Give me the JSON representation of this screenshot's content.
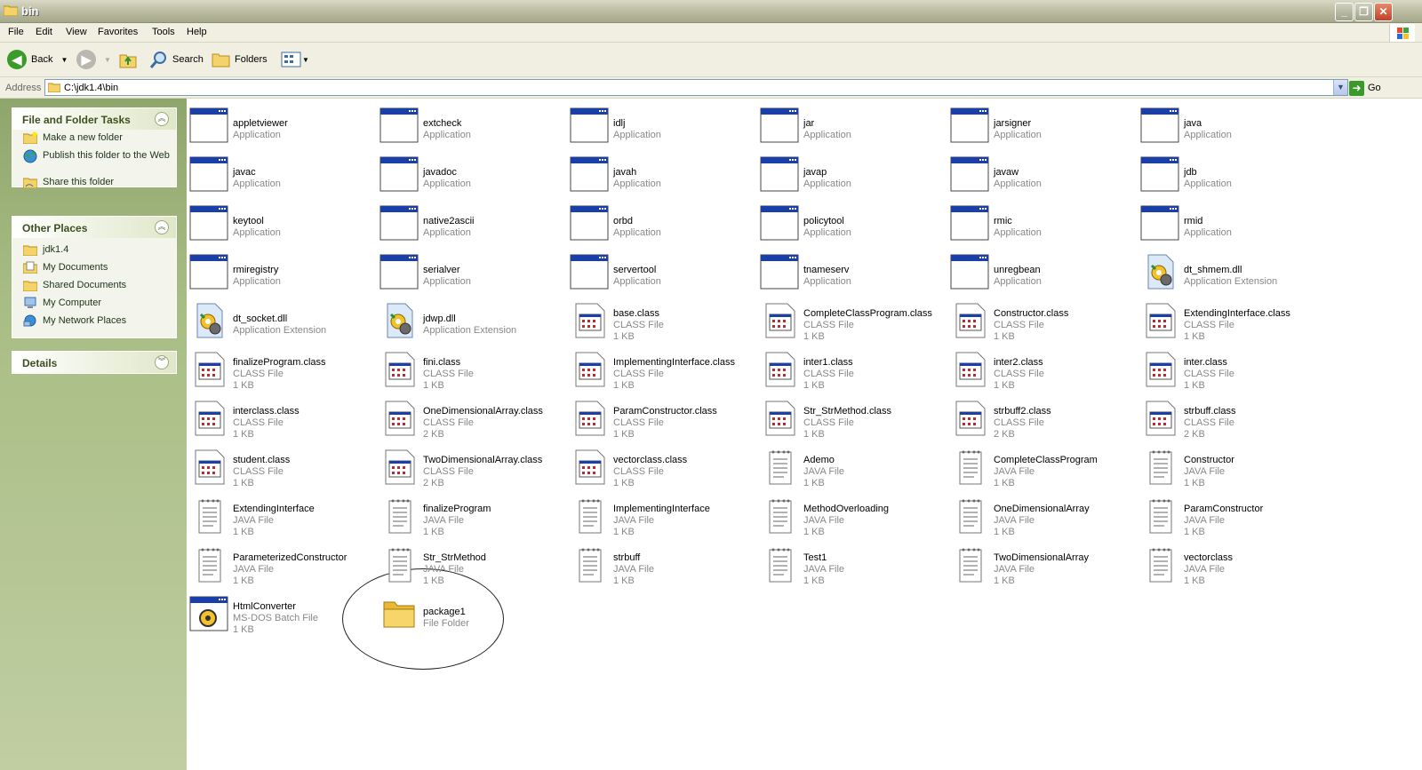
{
  "window": {
    "title": "bin"
  },
  "menu": [
    "File",
    "Edit",
    "View",
    "Favorites",
    "Tools",
    "Help"
  ],
  "toolbar": {
    "back_label": "Back",
    "search_label": "Search",
    "folders_label": "Folders"
  },
  "address": {
    "label": "Address",
    "value": "C:\\jdk1.4\\bin",
    "go_label": "Go"
  },
  "tasks_panel": {
    "title": "File and Folder Tasks",
    "items": [
      {
        "label": "Make a new folder",
        "icon": "new-folder-icon"
      },
      {
        "label": "Publish this folder to the Web",
        "icon": "globe-icon"
      },
      {
        "label": "Share this folder",
        "icon": "share-folder-icon"
      }
    ]
  },
  "places_panel": {
    "title": "Other Places",
    "items": [
      {
        "label": "jdk1.4",
        "icon": "folder-icon"
      },
      {
        "label": "My Documents",
        "icon": "documents-icon"
      },
      {
        "label": "Shared Documents",
        "icon": "folder-icon"
      },
      {
        "label": "My Computer",
        "icon": "computer-icon"
      },
      {
        "label": "My Network Places",
        "icon": "network-icon"
      }
    ]
  },
  "details_panel": {
    "title": "Details"
  },
  "files": [
    {
      "name": "appletviewer",
      "type": "Application",
      "size": "",
      "icon": "app"
    },
    {
      "name": "extcheck",
      "type": "Application",
      "size": "",
      "icon": "app"
    },
    {
      "name": "idlj",
      "type": "Application",
      "size": "",
      "icon": "app"
    },
    {
      "name": "jar",
      "type": "Application",
      "size": "",
      "icon": "app"
    },
    {
      "name": "jarsigner",
      "type": "Application",
      "size": "",
      "icon": "app"
    },
    {
      "name": "java",
      "type": "Application",
      "size": "",
      "icon": "app"
    },
    {
      "name": "javac",
      "type": "Application",
      "size": "",
      "icon": "app"
    },
    {
      "name": "javadoc",
      "type": "Application",
      "size": "",
      "icon": "app"
    },
    {
      "name": "javah",
      "type": "Application",
      "size": "",
      "icon": "app"
    },
    {
      "name": "javap",
      "type": "Application",
      "size": "",
      "icon": "app"
    },
    {
      "name": "javaw",
      "type": "Application",
      "size": "",
      "icon": "app"
    },
    {
      "name": "jdb",
      "type": "Application",
      "size": "",
      "icon": "app"
    },
    {
      "name": "keytool",
      "type": "Application",
      "size": "",
      "icon": "app"
    },
    {
      "name": "native2ascii",
      "type": "Application",
      "size": "",
      "icon": "app"
    },
    {
      "name": "orbd",
      "type": "Application",
      "size": "",
      "icon": "app"
    },
    {
      "name": "policytool",
      "type": "Application",
      "size": "",
      "icon": "app"
    },
    {
      "name": "rmic",
      "type": "Application",
      "size": "",
      "icon": "app"
    },
    {
      "name": "rmid",
      "type": "Application",
      "size": "",
      "icon": "app"
    },
    {
      "name": "rmiregistry",
      "type": "Application",
      "size": "",
      "icon": "app"
    },
    {
      "name": "serialver",
      "type": "Application",
      "size": "",
      "icon": "app"
    },
    {
      "name": "servertool",
      "type": "Application",
      "size": "",
      "icon": "app"
    },
    {
      "name": "tnameserv",
      "type": "Application",
      "size": "",
      "icon": "app"
    },
    {
      "name": "unregbean",
      "type": "Application",
      "size": "",
      "icon": "app"
    },
    {
      "name": "dt_shmem.dll",
      "type": "Application Extension",
      "size": "",
      "icon": "dll"
    },
    {
      "name": "dt_socket.dll",
      "type": "Application Extension",
      "size": "",
      "icon": "dll"
    },
    {
      "name": "jdwp.dll",
      "type": "Application Extension",
      "size": "",
      "icon": "dll"
    },
    {
      "name": "base.class",
      "type": "CLASS File",
      "size": "1 KB",
      "icon": "class"
    },
    {
      "name": "CompleteClassProgram.class",
      "type": "CLASS File",
      "size": "1 KB",
      "icon": "class"
    },
    {
      "name": "Constructor.class",
      "type": "CLASS File",
      "size": "1 KB",
      "icon": "class"
    },
    {
      "name": "ExtendingInterface.class",
      "type": "CLASS File",
      "size": "1 KB",
      "icon": "class"
    },
    {
      "name": "finalizeProgram.class",
      "type": "CLASS File",
      "size": "1 KB",
      "icon": "class"
    },
    {
      "name": "fini.class",
      "type": "CLASS File",
      "size": "1 KB",
      "icon": "class"
    },
    {
      "name": "ImplementingInterface.class",
      "type": "CLASS File",
      "size": "1 KB",
      "icon": "class"
    },
    {
      "name": "inter1.class",
      "type": "CLASS File",
      "size": "1 KB",
      "icon": "class"
    },
    {
      "name": "inter2.class",
      "type": "CLASS File",
      "size": "1 KB",
      "icon": "class"
    },
    {
      "name": "inter.class",
      "type": "CLASS File",
      "size": "1 KB",
      "icon": "class"
    },
    {
      "name": "interclass.class",
      "type": "CLASS File",
      "size": "1 KB",
      "icon": "class"
    },
    {
      "name": "OneDimensionalArray.class",
      "type": "CLASS File",
      "size": "2 KB",
      "icon": "class"
    },
    {
      "name": "ParamConstructor.class",
      "type": "CLASS File",
      "size": "1 KB",
      "icon": "class"
    },
    {
      "name": "Str_StrMethod.class",
      "type": "CLASS File",
      "size": "1 KB",
      "icon": "class"
    },
    {
      "name": "strbuff2.class",
      "type": "CLASS File",
      "size": "2 KB",
      "icon": "class"
    },
    {
      "name": "strbuff.class",
      "type": "CLASS File",
      "size": "2 KB",
      "icon": "class"
    },
    {
      "name": "student.class",
      "type": "CLASS File",
      "size": "1 KB",
      "icon": "class"
    },
    {
      "name": "TwoDimensionalArray.class",
      "type": "CLASS File",
      "size": "2 KB",
      "icon": "class"
    },
    {
      "name": "vectorclass.class",
      "type": "CLASS File",
      "size": "1 KB",
      "icon": "class"
    },
    {
      "name": "Ademo",
      "type": "JAVA File",
      "size": "1 KB",
      "icon": "java"
    },
    {
      "name": "CompleteClassProgram",
      "type": "JAVA File",
      "size": "1 KB",
      "icon": "java"
    },
    {
      "name": "Constructor",
      "type": "JAVA File",
      "size": "1 KB",
      "icon": "java"
    },
    {
      "name": "ExtendingInterface",
      "type": "JAVA File",
      "size": "1 KB",
      "icon": "java"
    },
    {
      "name": "finalizeProgram",
      "type": "JAVA File",
      "size": "1 KB",
      "icon": "java"
    },
    {
      "name": "ImplementingInterface",
      "type": "JAVA File",
      "size": "1 KB",
      "icon": "java"
    },
    {
      "name": "MethodOverloading",
      "type": "JAVA File",
      "size": "1 KB",
      "icon": "java"
    },
    {
      "name": "OneDimensionalArray",
      "type": "JAVA File",
      "size": "1 KB",
      "icon": "java"
    },
    {
      "name": "ParamConstructor",
      "type": "JAVA File",
      "size": "1 KB",
      "icon": "java"
    },
    {
      "name": "ParameterizedConstructor",
      "type": "JAVA File",
      "size": "1 KB",
      "icon": "java"
    },
    {
      "name": "Str_StrMethod",
      "type": "JAVA File",
      "size": "1 KB",
      "icon": "java"
    },
    {
      "name": "strbuff",
      "type": "JAVA File",
      "size": "1 KB",
      "icon": "java"
    },
    {
      "name": "Test1",
      "type": "JAVA File",
      "size": "1 KB",
      "icon": "java"
    },
    {
      "name": "TwoDimensionalArray",
      "type": "JAVA File",
      "size": "1 KB",
      "icon": "java"
    },
    {
      "name": "vectorclass",
      "type": "JAVA File",
      "size": "1 KB",
      "icon": "java"
    },
    {
      "name": "HtmlConverter",
      "type": "MS-DOS Batch File",
      "size": "1 KB",
      "icon": "bat"
    },
    {
      "name": "package1",
      "type": "File Folder",
      "size": "",
      "icon": "folder"
    }
  ]
}
